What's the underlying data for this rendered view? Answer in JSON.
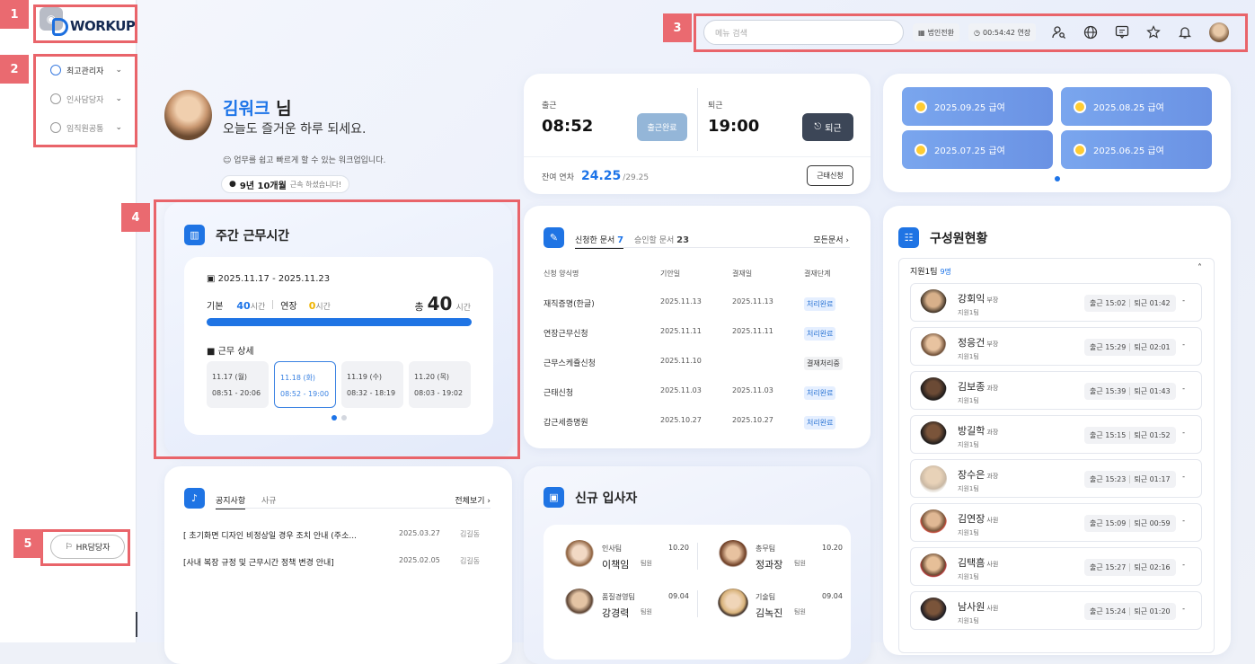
{
  "annotations": {
    "tags": [
      "1",
      "2",
      "3",
      "4",
      "5"
    ]
  },
  "logo": {
    "text": "WORKUP"
  },
  "sidebar": {
    "items": [
      {
        "label": "최고관리자"
      },
      {
        "label": "인사담당자"
      },
      {
        "label": "임직원공통"
      }
    ],
    "hr_button": "HR담당자"
  },
  "topbar": {
    "search_placeholder": "메뉴 검색",
    "corp_switch": "법인전환",
    "timer": "00:54:42 연장",
    "icons": [
      "user-search-icon",
      "globe-icon",
      "message-icon",
      "star-icon",
      "bell-icon",
      "avatar"
    ]
  },
  "profile": {
    "name": "김워크",
    "suffix": "님",
    "greeting": "오늘도 즐거운 하루 되세요.",
    "subtitle": "업무를 쉽고 빠르게 할 수 있는 워크업입니다.",
    "tenure": "9년 10개월",
    "tenure_note": "근속 하셨습니다!"
  },
  "attendance": {
    "in_label": "출근",
    "in_time": "08:52",
    "in_button": "출근완료",
    "out_label": "퇴근",
    "out_time": "19:00",
    "out_button": "퇴근",
    "leave_label": "잔여 연차",
    "leave_value": "24.25",
    "leave_total": "/29.25",
    "leave_button": "근태신청"
  },
  "payroll": {
    "items": [
      "2025.09.25 급여",
      "2025.08.25 급여",
      "2025.07.25 급여",
      "2025.06.25 급여"
    ]
  },
  "weekly": {
    "title": "주간 근무시간",
    "range": "2025.11.17 - 2025.11.23",
    "base_label": "기본",
    "base_value": "40",
    "base_unit": "시간",
    "ext_label": "연장",
    "ext_value": "0",
    "ext_unit": "시간",
    "total_label": "총",
    "total_value": "40",
    "total_unit": "시간",
    "progress": 1.0,
    "detail_title": "근무 상세",
    "days": [
      {
        "date": "11.17 (월)",
        "time": "08:51 - 20:06"
      },
      {
        "date": "11.18 (화)",
        "time": "08:52 - 19:00"
      },
      {
        "date": "11.19 (수)",
        "time": "08:32 - 18:19"
      },
      {
        "date": "11.20 (목)",
        "time": "08:03 - 19:02"
      }
    ]
  },
  "documents": {
    "tab_requested": "신청한 문서",
    "tab_requested_count": "7",
    "tab_approve": "승인할 문서",
    "tab_approve_count": "23",
    "all_link": "모든문서",
    "headers": [
      "신청 양식명",
      "기안일",
      "결재일",
      "결재단계"
    ],
    "rows": [
      {
        "name": "재직증명(한글)",
        "draft": "2025.11.13",
        "approved": "2025.11.13",
        "status": "처리완료"
      },
      {
        "name": "연장근무신청",
        "draft": "2025.11.11",
        "approved": "2025.11.11",
        "status": "처리완료"
      },
      {
        "name": "근무스케쥴신청",
        "draft": "2025.11.10",
        "approved": "",
        "status": "결재처리중"
      },
      {
        "name": "근태신청",
        "draft": "2025.11.03",
        "approved": "2025.11.03",
        "status": "처리완료"
      },
      {
        "name": "갑근세증명원",
        "draft": "2025.10.27",
        "approved": "2025.10.27",
        "status": "처리완료"
      }
    ]
  },
  "staff": {
    "title": "구성원현황",
    "team": "지원1팀",
    "team_count": "9명",
    "employees": [
      {
        "name": "강회익",
        "rank": "부장",
        "team": "지원1팀",
        "in": "출근 15:02",
        "out": "퇴근 01:42"
      },
      {
        "name": "정응건",
        "rank": "부장",
        "team": "지원1팀",
        "in": "출근 15:29",
        "out": "퇴근 02:01"
      },
      {
        "name": "김보종",
        "rank": "과장",
        "team": "지원1팀",
        "in": "출근 15:39",
        "out": "퇴근 01:43"
      },
      {
        "name": "방길학",
        "rank": "과장",
        "team": "지원1팀",
        "in": "출근 15:15",
        "out": "퇴근 01:52"
      },
      {
        "name": "장수은",
        "rank": "과장",
        "team": "지원1팀",
        "in": "출근 15:23",
        "out": "퇴근 01:17"
      },
      {
        "name": "김연장",
        "rank": "사원",
        "team": "지원1팀",
        "in": "출근 15:09",
        "out": "퇴근 00:59"
      },
      {
        "name": "김택흠",
        "rank": "사원",
        "team": "지원1팀",
        "in": "출근 15:27",
        "out": "퇴근 02:16"
      },
      {
        "name": "남사원",
        "rank": "사원",
        "team": "지원1팀",
        "in": "출근 15:24",
        "out": "퇴근 01:20"
      }
    ],
    "dash": "-"
  },
  "notice": {
    "tab_notice": "공지사항",
    "tab_rules": "사규",
    "all_link": "전체보기",
    "rows": [
      {
        "title": "[ 초기화면 디자인 비정상일 경우 조치 안내 (주소...",
        "date": "2025.03.27",
        "author": "김길동"
      },
      {
        "title": "[사내 복장 규정 및 근무시간 정책 변경 안내]",
        "date": "2025.02.05",
        "author": "김길동"
      }
    ]
  },
  "newhire": {
    "title": "신규 입사자",
    "people": [
      {
        "dept": "인사팀",
        "date": "10.20",
        "name": "이책임",
        "rank": "팀원"
      },
      {
        "dept": "총무팀",
        "date": "10.20",
        "name": "정과장",
        "rank": "팀원"
      },
      {
        "dept": "품질경영팀",
        "date": "09.04",
        "name": "강경력",
        "rank": "팀원"
      },
      {
        "dept": "기술팀",
        "date": "09.04",
        "name": "김녹진",
        "rank": "팀원"
      }
    ]
  },
  "colors": {
    "accent": "#1d74e8",
    "annotation": "#ea6a70",
    "dark_button": "#3c4657"
  }
}
